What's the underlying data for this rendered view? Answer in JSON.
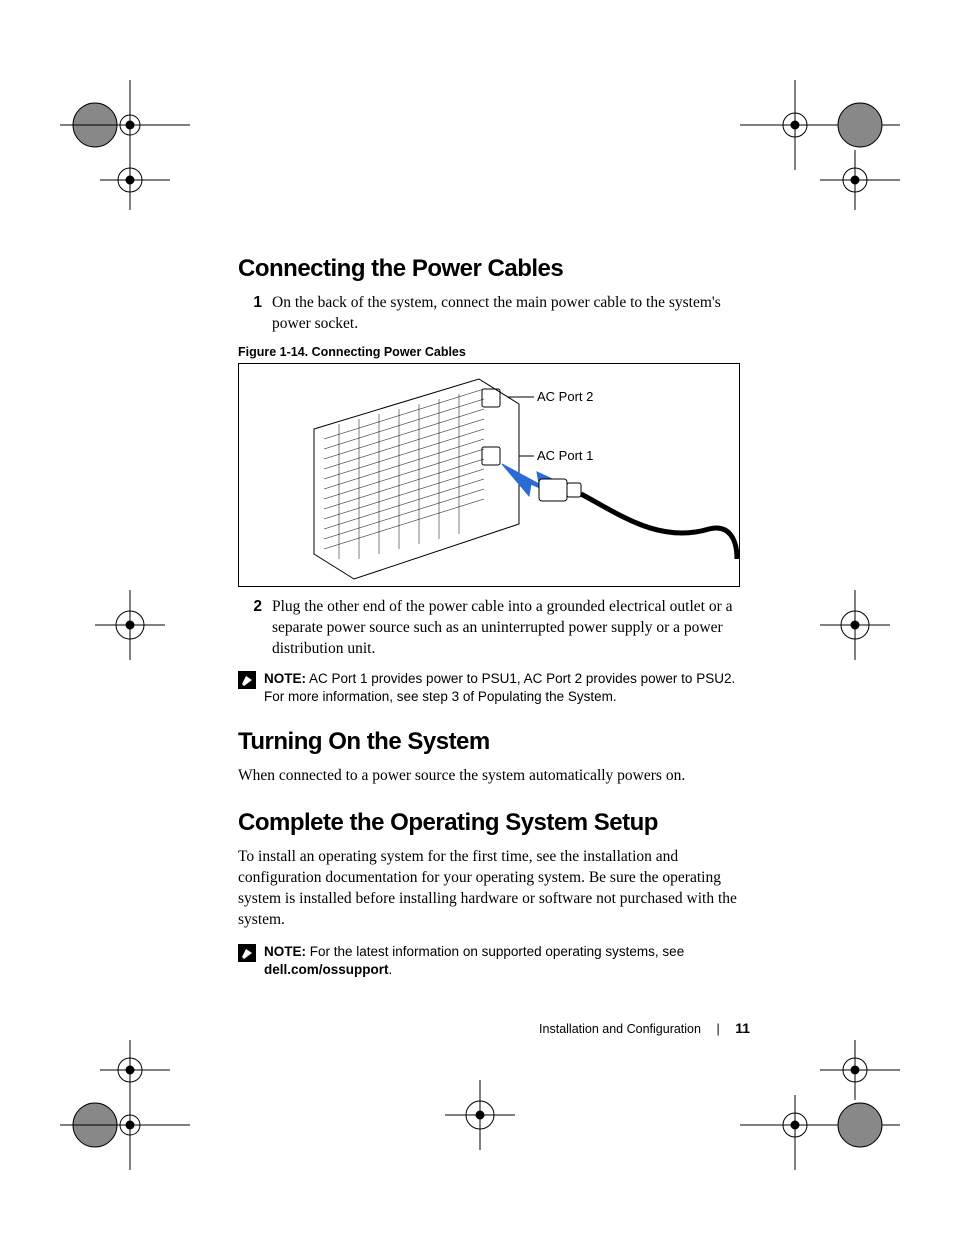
{
  "headings": {
    "h1": "Connecting the Power Cables",
    "h2": "Turning On the System",
    "h3": "Complete the Operating System Setup"
  },
  "steps": {
    "s1_num": "1",
    "s1_text": "On the back of the system, connect the main power cable to the system's power socket.",
    "s2_num": "2",
    "s2_text": "Plug the other end of the power cable into a grounded electrical outlet or a separate power source such as an uninterrupted power supply or a power distribution unit."
  },
  "figure": {
    "caption": "Figure 1-14.    Connecting Power Cables",
    "label1": "AC Port 2",
    "label2": "AC Port 1"
  },
  "notes": {
    "n1_bold": "NOTE:",
    "n1_text": " AC Port 1 provides power to PSU1, AC Port 2 provides power to PSU2. For more information, see step 3 of Populating the System.",
    "n2_bold": "NOTE:",
    "n2_text": " For the latest information on supported operating systems, see ",
    "n2_link": "dell.com/ossupport",
    "n2_tail": "."
  },
  "paras": {
    "p1": "When connected to a power source the system automatically powers on.",
    "p2": "To install an operating system for the first time, see the installation and configuration documentation for your operating system. Be sure the operating system is installed before installing hardware or software not purchased with the system."
  },
  "footer": {
    "section": "Installation and Configuration",
    "page": "11"
  }
}
